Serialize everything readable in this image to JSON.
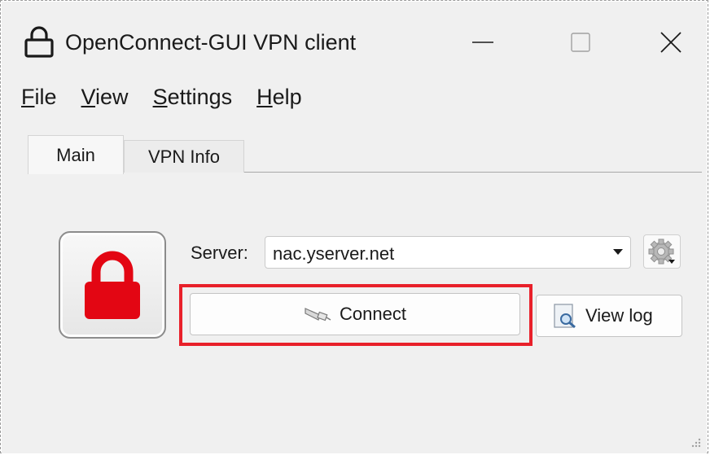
{
  "window": {
    "title": "OpenConnect-GUI VPN client",
    "app_icon": "lock-outline-icon",
    "controls": [
      "minimize-icon",
      "maximize-icon",
      "close-icon"
    ]
  },
  "menubar": {
    "items": [
      {
        "accel": "F",
        "rest": "ile"
      },
      {
        "accel": "V",
        "rest": "iew"
      },
      {
        "accel": "S",
        "rest": "ettings"
      },
      {
        "accel": "H",
        "rest": "elp"
      }
    ]
  },
  "tabs": [
    {
      "label": "Main",
      "selected": true
    },
    {
      "label": "VPN Info",
      "selected": false
    }
  ],
  "main": {
    "status_icon": "red-lock-icon",
    "server_label": "Server:",
    "server_value": "nac.yserver.net",
    "connect_label": "Connect",
    "view_log_label": "View log"
  },
  "colors": {
    "lock_red": "#e30613",
    "highlight_red": "#e8202a",
    "window_bg": "#f0f0f0"
  }
}
